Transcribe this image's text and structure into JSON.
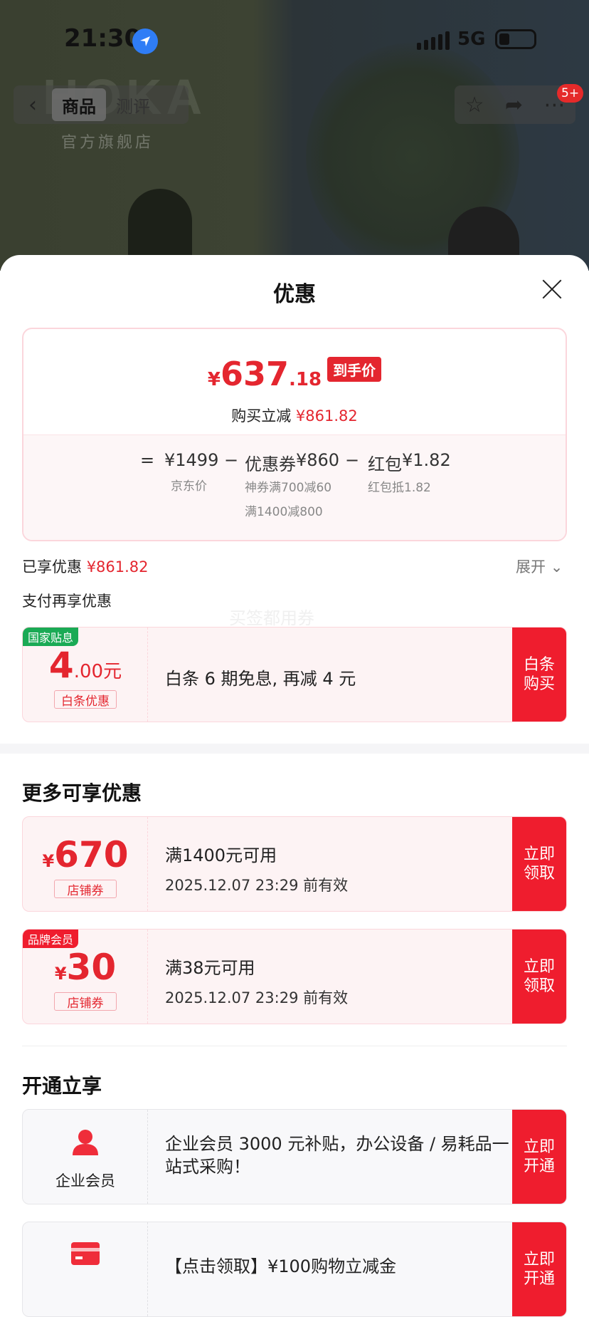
{
  "status_bar": {
    "time": "21:30",
    "network": "5G"
  },
  "background": {
    "brand_text": "HOKA",
    "store_text": "官方旗舰店"
  },
  "header": {
    "back_icon": "chevron-left-icon",
    "tabs": [
      {
        "label": "商品",
        "active": true
      },
      {
        "label": "测评",
        "active": false
      }
    ],
    "right_icons": [
      "star-icon",
      "share-icon",
      "more-icon"
    ],
    "notification_badge": "5+"
  },
  "sheet": {
    "title": "优惠",
    "price": {
      "currency": "¥",
      "integer": "637",
      "decimal": ".18",
      "tag": "到手价"
    },
    "buy_save": {
      "label": "购买立减",
      "amount": "¥861.82"
    },
    "formula": {
      "equals": "=",
      "minus": "−",
      "jd_price": "¥1499",
      "jd_price_label": "京东价",
      "coupon_label": "优惠券",
      "coupon_amount": "¥860",
      "coupon_detail_1": "神券满700减60",
      "coupon_detail_2": "满1400减800",
      "redpacket_label": "红包",
      "redpacket_amount": "¥1.82",
      "redpacket_detail": "红包抵1.82"
    },
    "enjoyed": {
      "label": "已享优惠",
      "amount": "¥861.82"
    },
    "expand": "展开",
    "pay_more": "支付再享优惠",
    "watermark": "买签都用券",
    "pay_coupon": {
      "corner": "国家贴息",
      "amount_int": "4",
      "amount_dec": ".00",
      "amount_unit": "元",
      "tag": "白条优惠",
      "desc": "白条 6 期免息, 再减 4 元",
      "button": "白条\n购买"
    },
    "more_section_title": "更多可享优惠",
    "coupons": [
      {
        "currency": "¥",
        "amount": "670",
        "tag": "店铺券",
        "condition": "满1400元可用",
        "expiry": "2025.12.07 23:29 前有效",
        "button": "立即\n领取",
        "corner": ""
      },
      {
        "currency": "¥",
        "amount": "30",
        "tag": "店铺券",
        "condition": "满38元可用",
        "expiry": "2025.12.07 23:29 前有效",
        "button": "立即\n领取",
        "corner": "品牌会员"
      }
    ],
    "open_section_title": "开通立享",
    "memberships": [
      {
        "icon": "person-icon",
        "label": "企业会员",
        "desc": "企业会员 3000 元补贴，办公设备 / 易耗品一站式采购！",
        "button": "立即\n开通"
      },
      {
        "icon": "card-icon",
        "label": "",
        "desc": "【点击领取】¥100购物立减金",
        "button": "立即\n开通"
      }
    ],
    "colors": {
      "accent": "#ef1d2e",
      "price_red": "#e4262f",
      "green_corner": "#1aaa55"
    }
  }
}
